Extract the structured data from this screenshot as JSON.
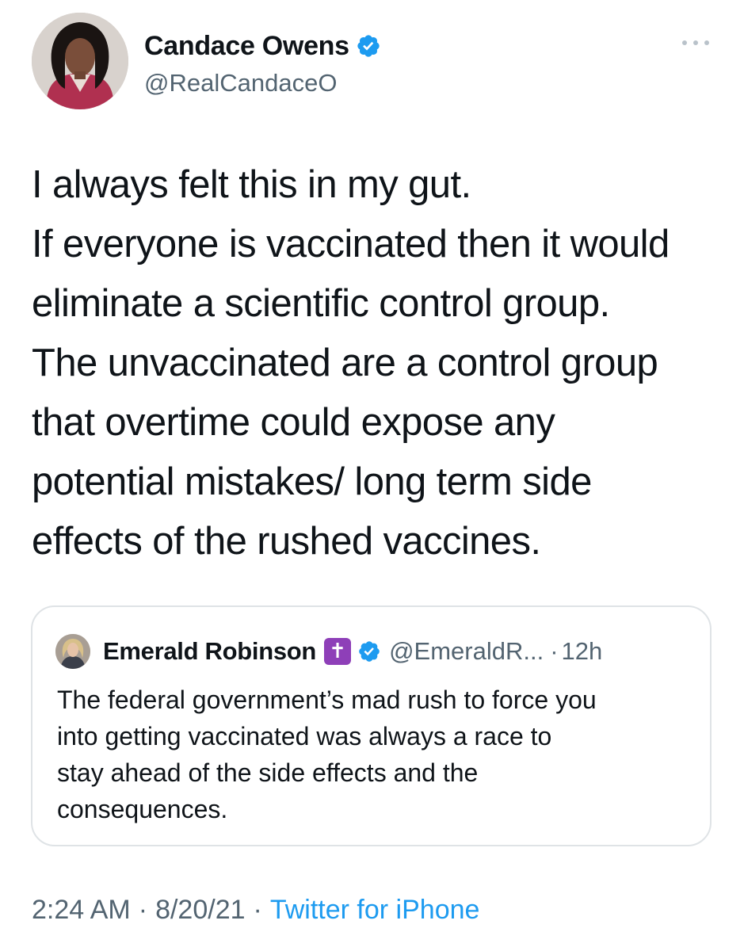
{
  "tweet": {
    "author": {
      "name": "Candace Owens",
      "handle": "@RealCandaceO",
      "verified": true
    },
    "text_lines": [
      "I always felt this in my gut.",
      "If everyone is vaccinated then it would",
      "eliminate a scientific control group.",
      "The unvaccinated are a control group",
      "that overtime could expose any",
      "potential mistakes/ long term side",
      "effects of the rushed vaccines."
    ],
    "more_icon": "more-horizontal-icon"
  },
  "quoted": {
    "name": "Emerald Robinson",
    "emoji": "✝",
    "verified": true,
    "handle": "@EmeraldR...",
    "separator": "·",
    "time": "12h",
    "text_lines": [
      "The federal government’s mad rush to force you",
      "into getting vaccinated was always a race to",
      "stay ahead of the side effects and the",
      "consequences."
    ]
  },
  "meta": {
    "time": "2:24 AM",
    "dot1": "·",
    "date": "8/20/21",
    "dot2": "·",
    "source": "Twitter for iPhone"
  },
  "colors": {
    "text": "#0f1419",
    "secondary": "#536471",
    "verified": "#1d9bf0",
    "link": "#1d9bf0",
    "card_border": "#dfe3e6",
    "emoji_bg": "#8e3fb8"
  }
}
